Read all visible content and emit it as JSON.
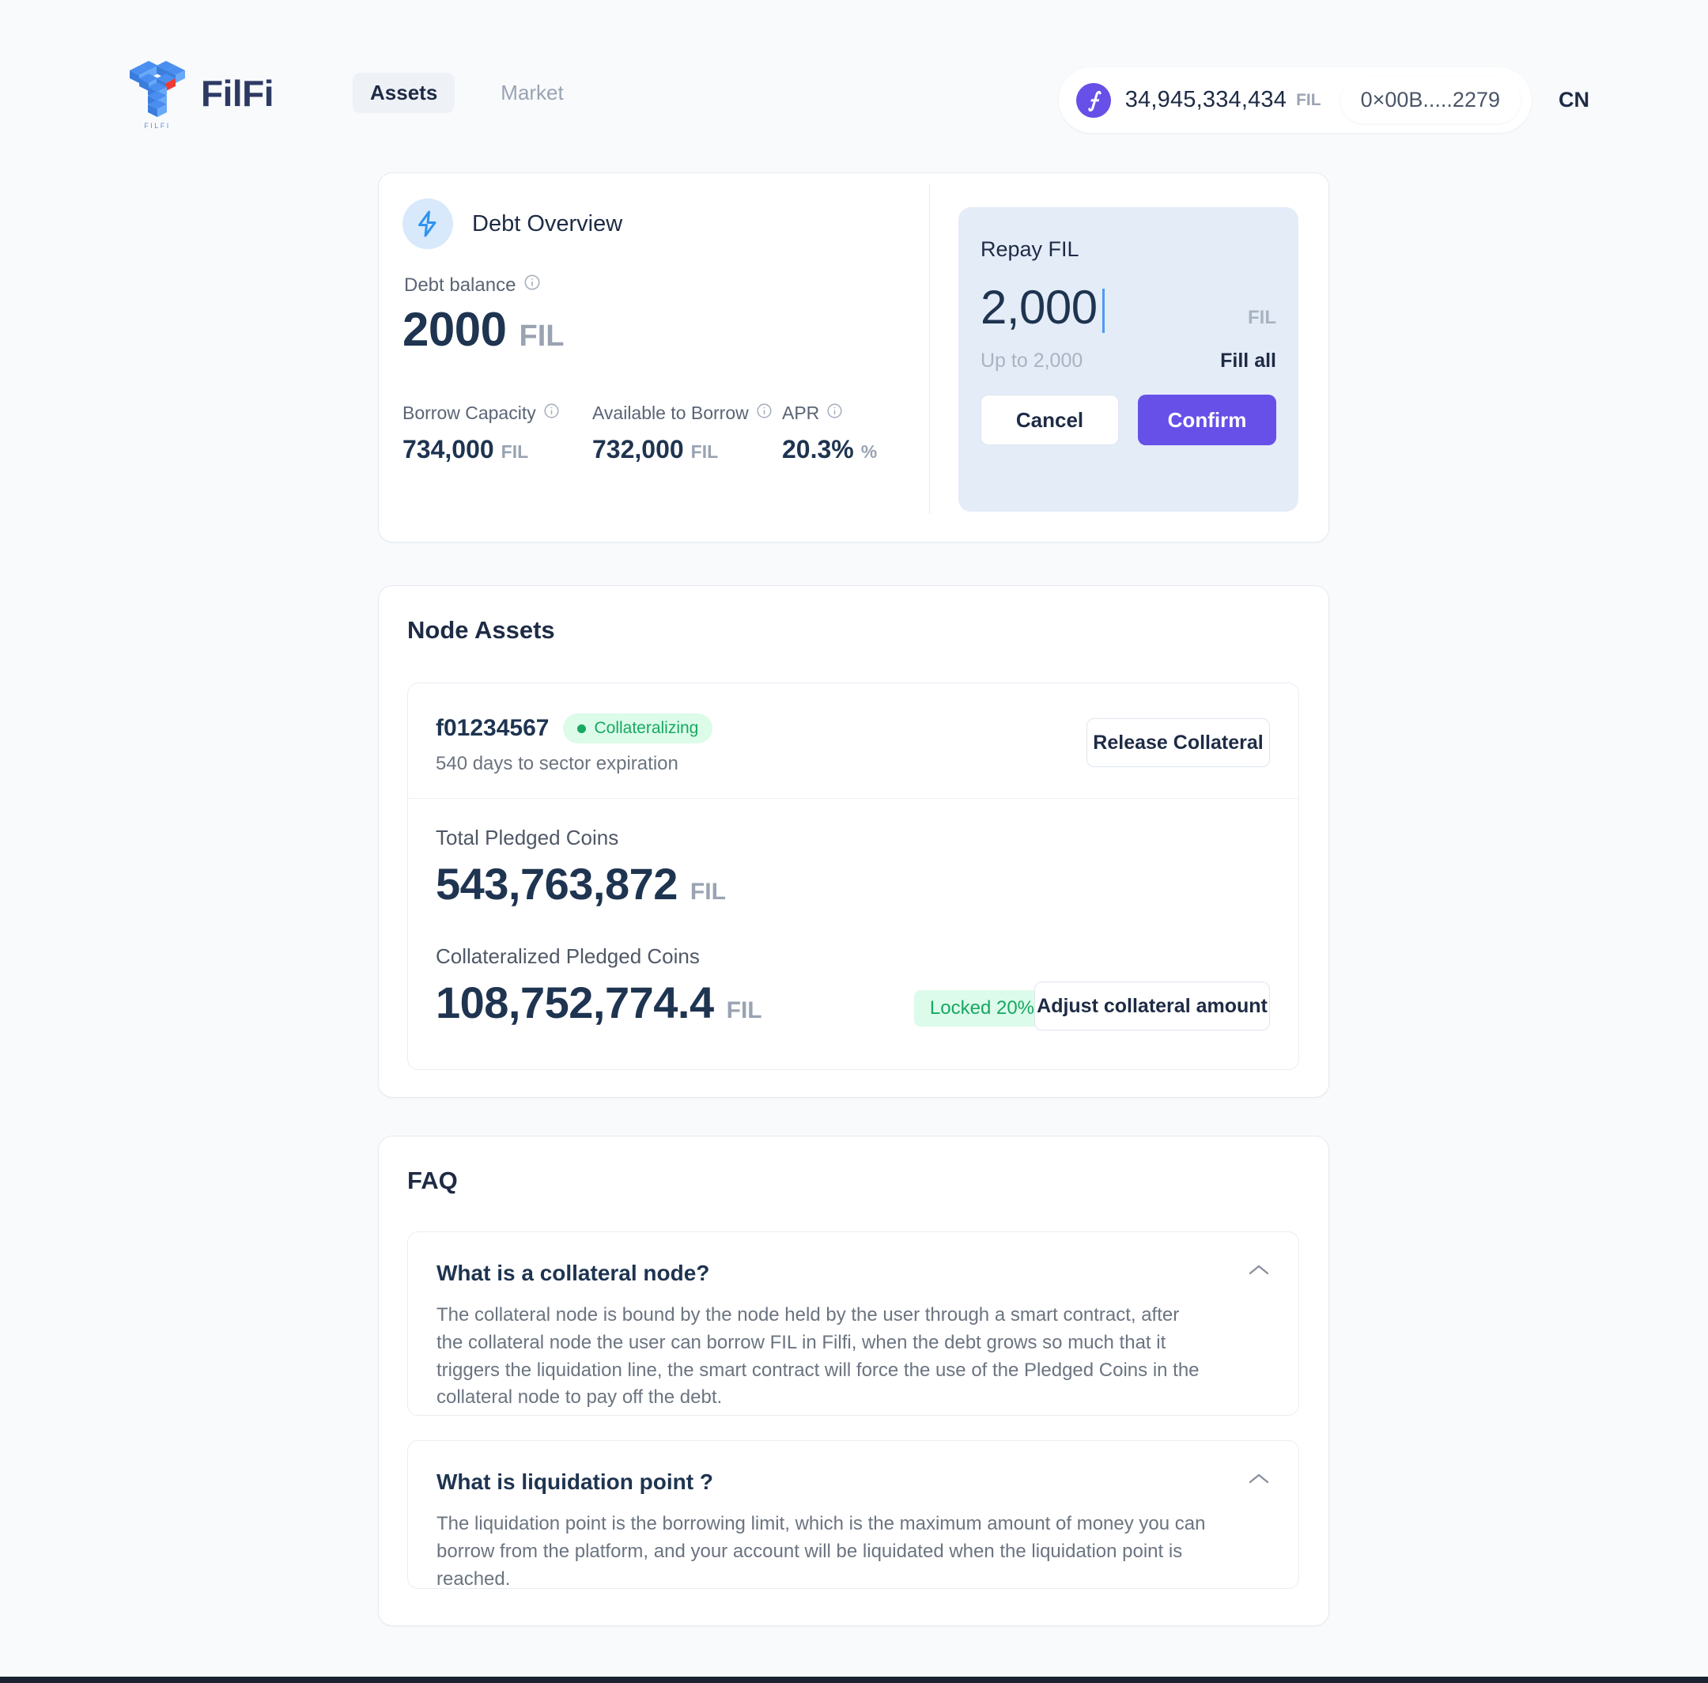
{
  "header": {
    "brand_name": "FilFi",
    "logo_icon": "filfi-cube-logo-icon",
    "logo_caption": "FILFI",
    "nav": [
      {
        "label": "Assets",
        "active": true
      },
      {
        "label": "Market",
        "active": false
      }
    ],
    "balance": {
      "coin_icon": "filecoin-coin-icon",
      "amount": "34,945,334,434",
      "unit": "FIL"
    },
    "wallet_address": "0×00B.....2279",
    "language": "CN"
  },
  "debt_overview": {
    "icon": "lightning-bolt-icon",
    "title": "Debt Overview",
    "debt_balance_label": "Debt balance",
    "debt_balance_info_icon": "info-circle-icon",
    "debt_balance_value": "2000",
    "debt_balance_unit": "FIL",
    "metrics": [
      {
        "label": "Borrow Capacity",
        "info_icon": "info-circle-icon",
        "value": "734,000",
        "unit": "FIL"
      },
      {
        "label": "Available to Borrow",
        "info_icon": "info-circle-icon",
        "value": "732,000",
        "unit": "FIL"
      },
      {
        "label": "APR",
        "info_icon": "info-circle-icon",
        "value": "20.3%",
        "unit": "%"
      }
    ]
  },
  "repay": {
    "title": "Repay FIL",
    "amount_value": "2,000",
    "unit": "FIL",
    "hint": "Up to 2,000",
    "fill_all_label": "Fill all",
    "cancel_label": "Cancel",
    "confirm_label": "Confirm"
  },
  "node_assets": {
    "title": "Node Assets",
    "node_id": "f01234567",
    "status_badge": "Collateralizing",
    "status_dot_icon": "status-dot-icon",
    "expiration": "540 days to sector expiration",
    "release_button": "Release Collateral",
    "total_pledged_label": "Total Pledged Coins",
    "total_pledged_value": "543,763,872",
    "total_pledged_unit": "FIL",
    "collateralized_label": "Collateralized Pledged Coins",
    "collateralized_value": "108,752,774.4",
    "collateralized_unit": "FIL",
    "locked_badge": "Locked 20%",
    "adjust_button": "Adjust collateral amount"
  },
  "faq": {
    "title": "FAQ",
    "items": [
      {
        "question": "What is a collateral node?",
        "answer": "The collateral node is bound by the node held by the user through a smart contract, after the collateral node the user can borrow FIL in Filfi, when the debt grows so much that it triggers the liquidation line, the smart contract will force the use of the Pledged Coins in the collateral node to pay off the debt.",
        "chevron_icon": "chevron-up-icon"
      },
      {
        "question": "What is liquidation point ?",
        "answer": "The liquidation point is the borrowing limit, which is the maximum amount of money you can borrow from the platform, and your account will be liquidated when the liquidation point is reached.",
        "chevron_icon": "chevron-up-icon"
      }
    ]
  },
  "colors": {
    "page_background": "#f8fafc",
    "accent_purple": "#6750e8",
    "panel_blue": "#e4ecf8",
    "text_dark": "#1e3450",
    "text_muted": "#9aa3b2",
    "success_green": "#17a862",
    "bolt_blue": "#3b9df5"
  }
}
